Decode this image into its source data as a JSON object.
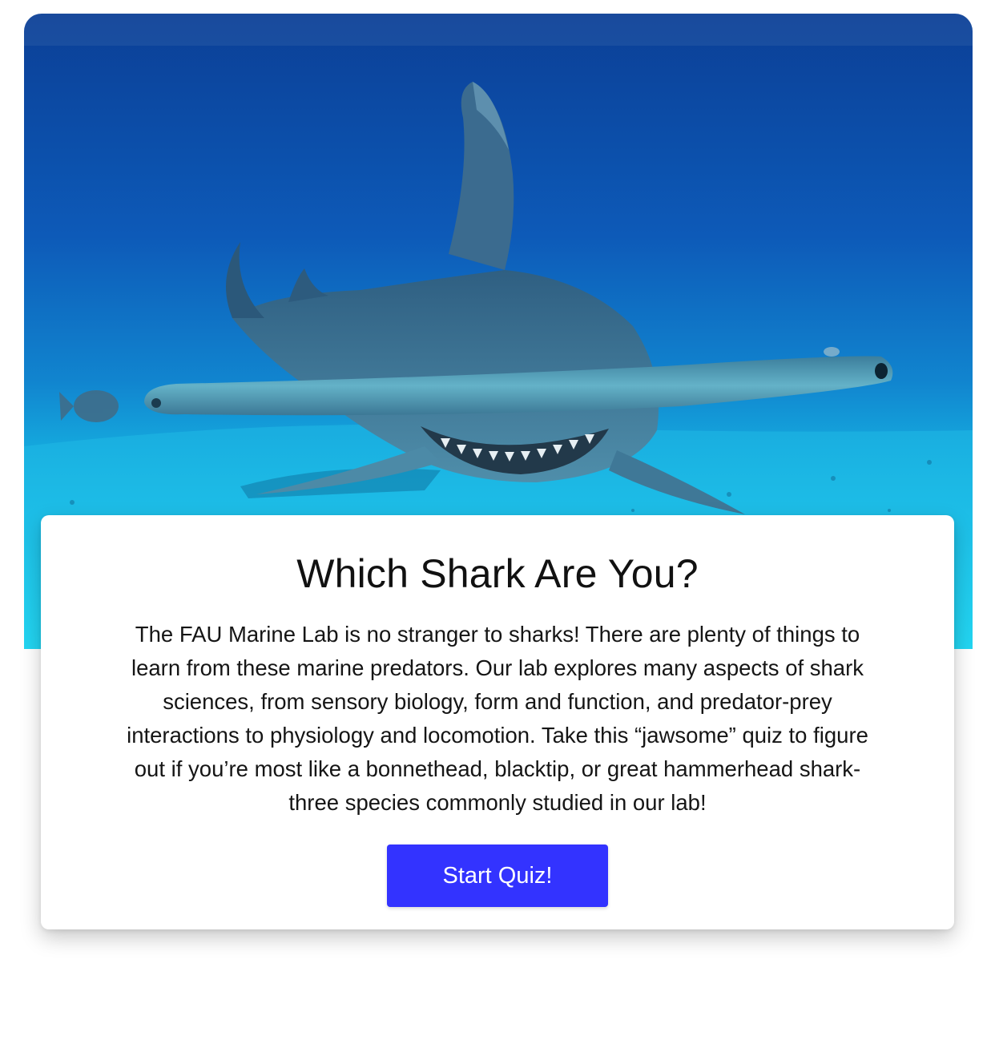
{
  "hero": {
    "image_subject": "hammerhead shark swimming over sandy seafloor"
  },
  "quiz_card": {
    "title": "Which Shark Are You?",
    "description": "The FAU Marine Lab is no stranger to sharks! There are plenty of things to learn from these marine predators. Our lab explores many aspects of shark sciences, from sensory biology, form and function, and predator-prey interactions to physiology and locomotion. Take this “jawsome” quiz to figure out if you’re most like a bonnethead, blacktip, or great hammerhead shark- three species commonly studied in our lab!",
    "start_button_label": "Start Quiz!"
  },
  "colors": {
    "button_background": "#3333ff",
    "button_text": "#ffffff",
    "ocean_deep": "#0a4fa8",
    "ocean_shallow": "#16c3e8",
    "shark_body": "#3d6f8f"
  }
}
